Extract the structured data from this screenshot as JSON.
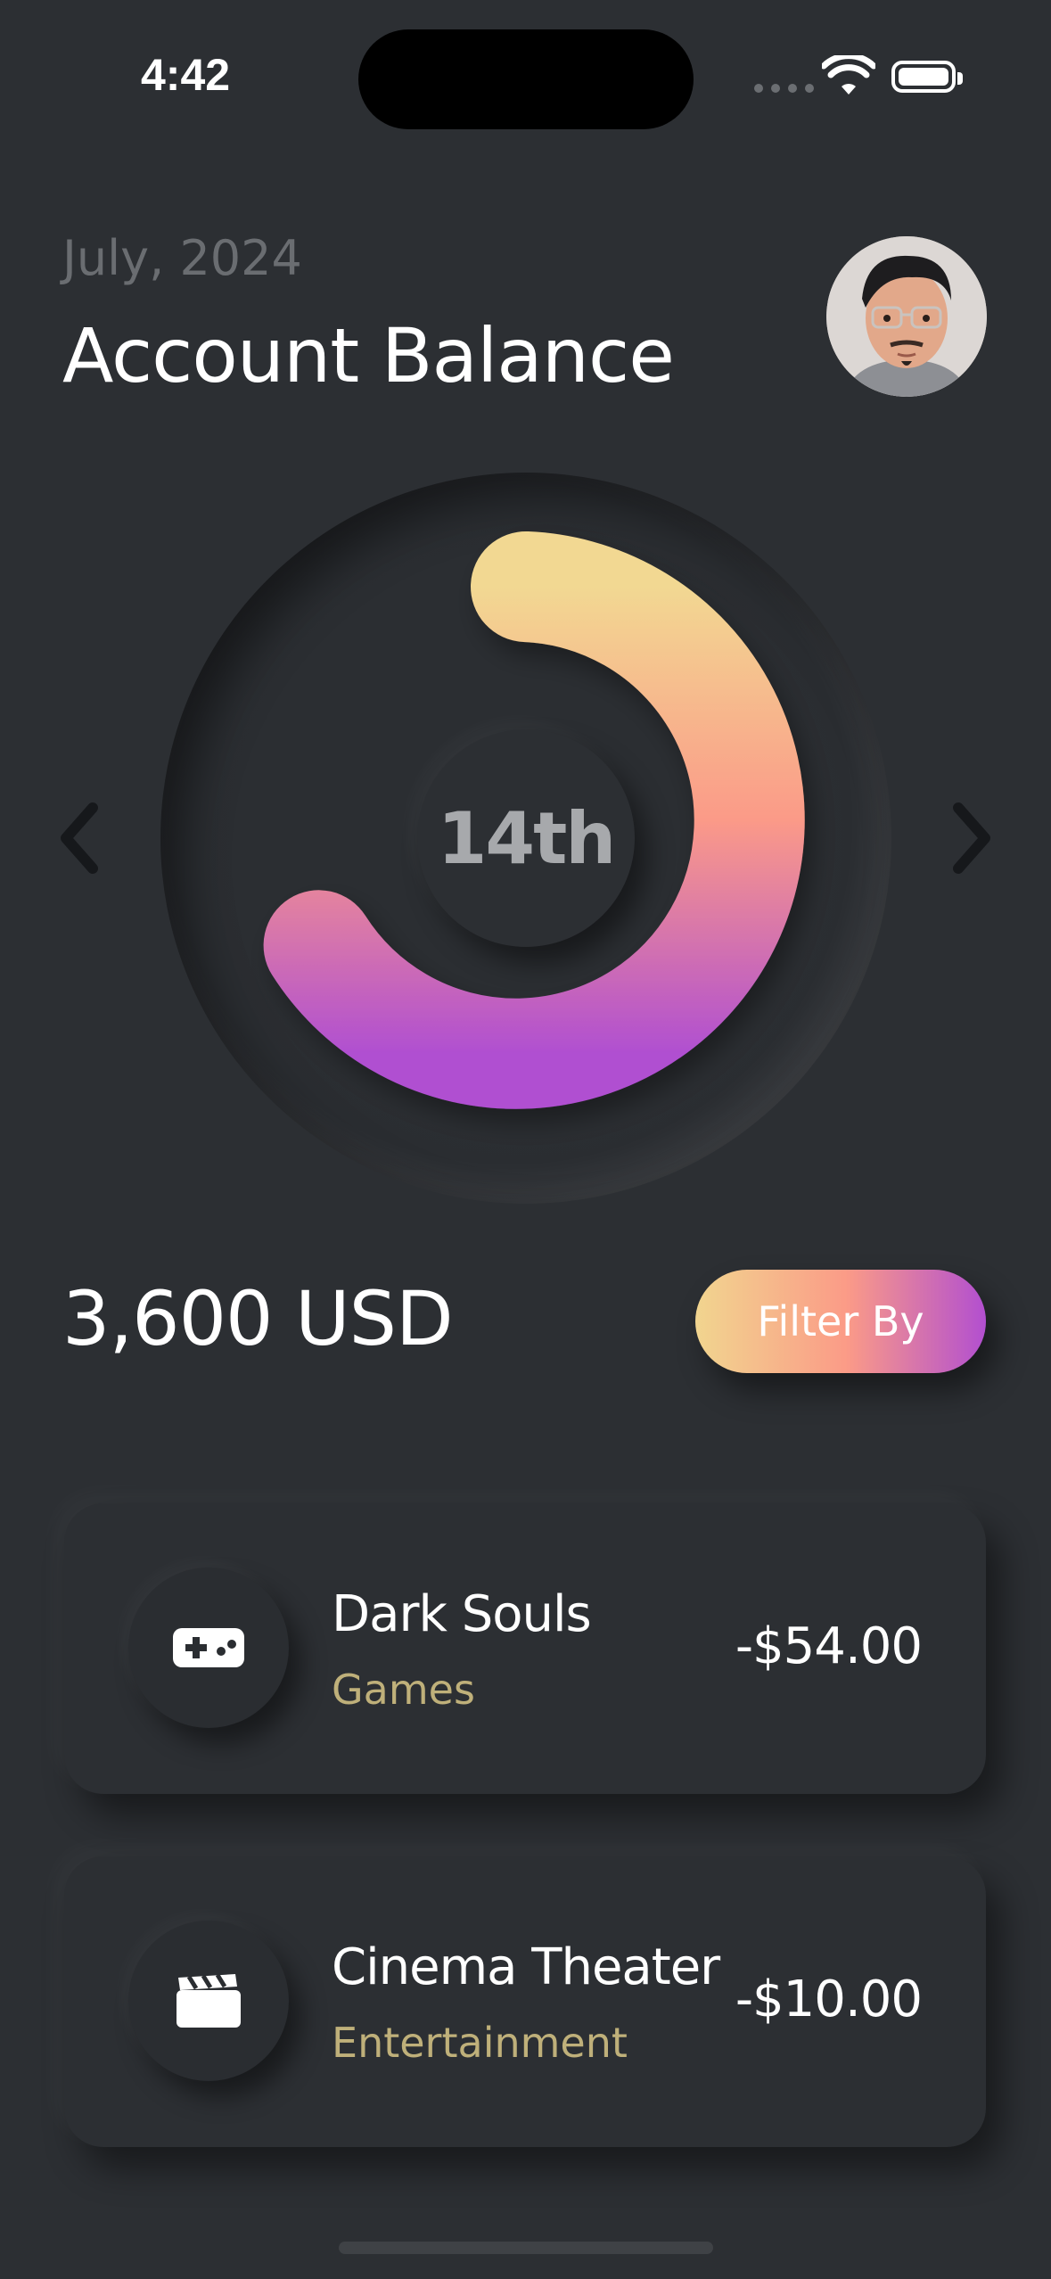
{
  "status_bar": {
    "time": "4:42"
  },
  "header": {
    "month": "July, 2024",
    "title": "Account Balance"
  },
  "ring": {
    "center_label": "14th",
    "gradient_colors": [
      "#f2d892",
      "#fb9a88",
      "#b04fd1"
    ]
  },
  "balance": {
    "amount": "3,600 USD",
    "filter_label": "Filter By"
  },
  "transactions": [
    {
      "name": "Dark Souls",
      "category": "Games",
      "amount": "-$54.00",
      "icon": "gamepad-icon"
    },
    {
      "name": "Cinema Theater",
      "category": "Entertainment",
      "amount": "-$10.00",
      "icon": "clapperboard-icon"
    }
  ],
  "colors": {
    "background": "#2c2f33",
    "category_text": "#bfb07a",
    "muted_text": "#6a6d71"
  }
}
